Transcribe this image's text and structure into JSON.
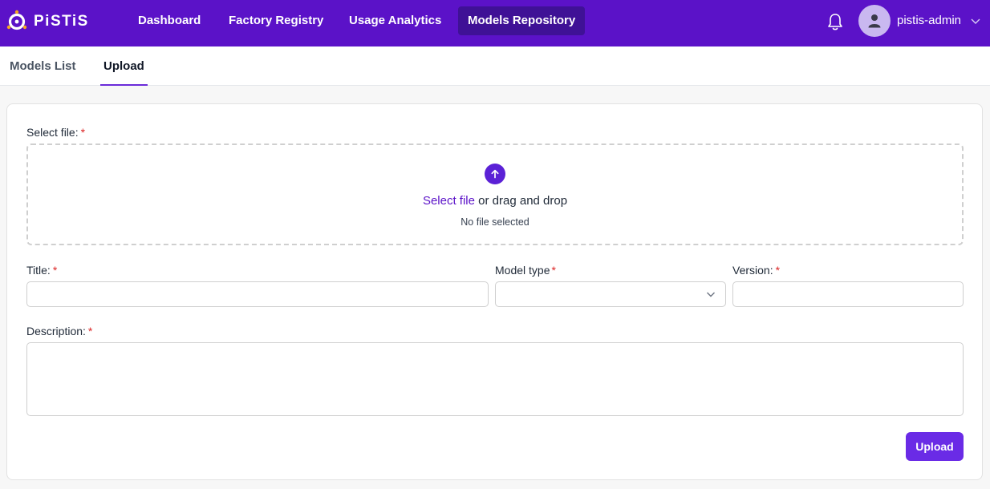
{
  "brand": {
    "name": "PiSTiS",
    "accent": "#5b12c8"
  },
  "nav": {
    "items": [
      {
        "label": "Dashboard"
      },
      {
        "label": "Factory Registry"
      },
      {
        "label": "Usage Analytics"
      },
      {
        "label": "Models Repository"
      }
    ],
    "active_item": "Models Repository",
    "icons": {
      "notifications": "bell-icon",
      "user": "person-icon",
      "menu": "chevron-down-icon"
    },
    "user": {
      "name": "pistis-admin"
    }
  },
  "subnav": {
    "tabs": [
      {
        "label": "Models List"
      },
      {
        "label": "Upload"
      }
    ],
    "active_tab": "Upload"
  },
  "form": {
    "file": {
      "label": "Select file:",
      "required_mark": "*",
      "select_link": "Select file",
      "drag_text": " or drag and drop",
      "status": "No file selected",
      "icon": "arrow-up-icon"
    },
    "title": {
      "label": "Title:",
      "required_mark": "*",
      "value": ""
    },
    "model_type": {
      "label": "Model type",
      "required_mark": "*",
      "value": ""
    },
    "version": {
      "label": "Version:",
      "required_mark": "*",
      "value": ""
    },
    "description": {
      "label": "Description:",
      "required_mark": "*",
      "value": ""
    },
    "submit_label": "Upload"
  }
}
